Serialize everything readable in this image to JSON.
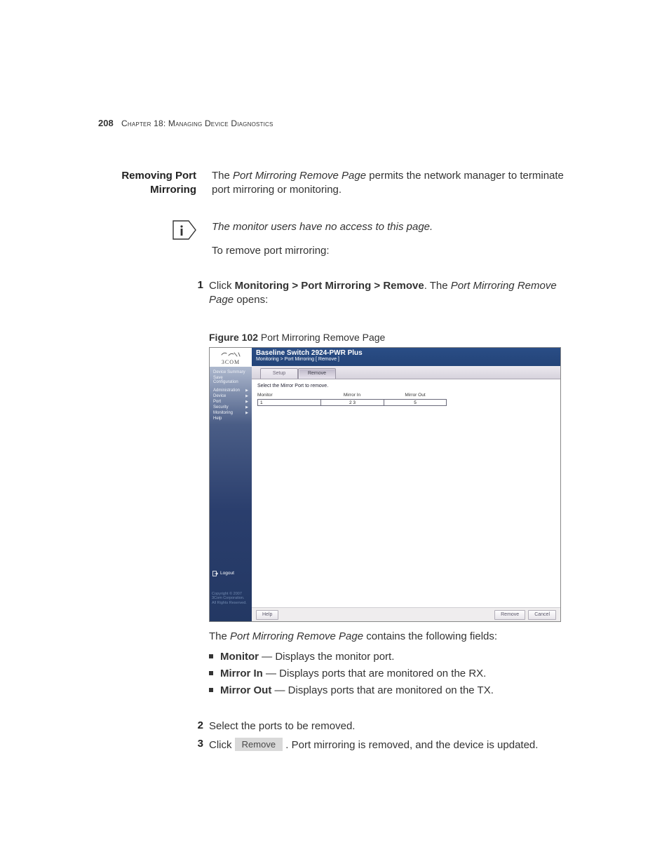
{
  "header": {
    "page_number": "208",
    "chapter_label": "Chapter 18: ",
    "chapter_title": "Managing Device Diagnostics"
  },
  "section": {
    "side_heading_l1": "Removing Port",
    "side_heading_l2": "Mirroring",
    "intro_pre": "The ",
    "intro_page_name": "Port Mirroring Remove Page",
    "intro_post": " permits the network manager to terminate port mirroring or monitoring.",
    "note_text": "The monitor users have no access to this page.",
    "to_remove": "To remove port mirroring:"
  },
  "steps": {
    "s1_num": "1",
    "s1_pre": "Click ",
    "s1_path": "Monitoring > Port Mirroring > Remove",
    "s1_mid": ". The ",
    "s1_ital": "Port Mirroring Remove Page",
    "s1_post": " opens:",
    "s2_num": "2",
    "s2_text": "Select the ports to be removed.",
    "s3_num": "3",
    "s3_pre": "Click ",
    "s3_btn": "Remove",
    "s3_post": ". Port mirroring is removed, and the device is updated."
  },
  "figure": {
    "caption_bold": "Figure 102",
    "caption_rest": "   Port Mirroring Remove Page",
    "logo_text": "3COM",
    "nav": {
      "device_summary": "Device Summary",
      "save_config": "Save Configuration",
      "administration": "Administration",
      "device": "Device",
      "port": "Port",
      "security": "Security",
      "monitoring": "Monitoring",
      "help": "Help"
    },
    "logout": "Logout",
    "copyright_l1": "Copyright © 2007",
    "copyright_l2": "3Com Corporation.",
    "copyright_l3": "All Rights Reserved.",
    "title": "Baseline Switch 2924-PWR Plus",
    "breadcrumb": "Monitoring > Port Mirroring [ Remove ]",
    "tabs": {
      "setup": "Setup",
      "remove": "Remove"
    },
    "instruction": "Select the Mirror Port to remove.",
    "columns": {
      "c1": "Monitor",
      "c2": "Mirror In",
      "c3": "Mirror Out"
    },
    "row1": {
      "c1": "1",
      "c2": "2 3",
      "c3": "5"
    },
    "buttons": {
      "help": "Help",
      "remove": "Remove",
      "cancel": "Cancel"
    }
  },
  "after": {
    "contains_pre": "The ",
    "contains_ital": "Port Mirroring Remove Page",
    "contains_post": " contains the following fields:",
    "b1_label": "Monitor",
    "b1_text": " — Displays the monitor port.",
    "b2_label": "Mirror In",
    "b2_text": " — Displays ports that are monitored on the RX.",
    "b3_label": "Mirror Out",
    "b3_text": " — Displays ports that are monitored on the TX."
  }
}
